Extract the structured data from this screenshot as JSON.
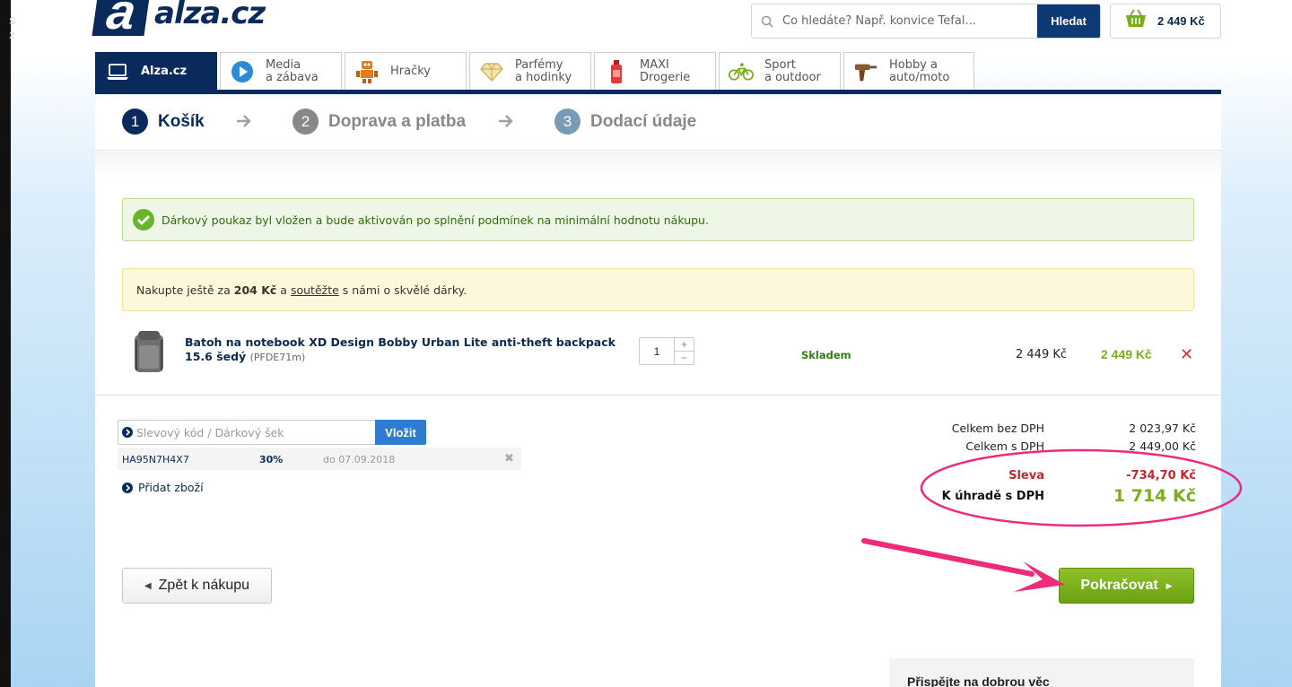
{
  "side_chars": [
    "S",
    "2"
  ],
  "header": {
    "logo_text": "alza.cz",
    "logo_letter": "a",
    "search_placeholder": "Co hledáte? Např. konvice Tefal...",
    "search_button": "Hledat",
    "basket_total": "2 449 Kč"
  },
  "nav": {
    "tabs": [
      {
        "line1": "Alza.cz",
        "line2": "",
        "icon": "laptop-icon"
      },
      {
        "line1": "Media",
        "line2": "a zábava",
        "icon": "play-icon"
      },
      {
        "line1": "Hračky",
        "line2": "",
        "icon": "robot-icon"
      },
      {
        "line1": "Parfémy",
        "line2": "a hodinky",
        "icon": "diamond-icon"
      },
      {
        "line1": "MAXI",
        "line2": "Drogerie",
        "icon": "bottle-icon"
      },
      {
        "line1": "Sport",
        "line2": "a outdoor",
        "icon": "bicycle-icon"
      },
      {
        "line1": "Hobby a",
        "line2": "auto/moto",
        "icon": "drill-icon"
      }
    ]
  },
  "steps": [
    {
      "num": "1",
      "label": "Košík"
    },
    {
      "num": "2",
      "label": "Doprava a platba"
    },
    {
      "num": "3",
      "label": "Dodací údaje"
    }
  ],
  "alerts": {
    "success": "Dárkový poukaz byl vložen a bude aktivován po splnění podmínek na minimální hodnotu nákupu.",
    "info_prefix": "Nakupte ještě za",
    "info_amount": "204 Kč",
    "info_mid": "a",
    "info_link": "soutěžte",
    "info_suffix": "s námi o skvělé dárky."
  },
  "cart_item": {
    "name": "Batoh na notebook XD Design Bobby Urban Lite anti-theft backpack 15.6 šedý",
    "code": "(PFDE71m)",
    "quantity": "1",
    "stock": "Skladem",
    "unit_price": "2 449 Kč",
    "total_price": "2 449 Kč"
  },
  "voucher": {
    "placeholder": "Slevový kód / Dárkový šek",
    "button": "Vložit",
    "applied_code": "HA95N7H4X7",
    "applied_percent": "30%",
    "applied_valid": "do 07.09.2018",
    "add_item": "Přidat zboží"
  },
  "summary": {
    "without_vat_label": "Celkem bez DPH",
    "without_vat_value": "2 023,97 Kč",
    "with_vat_label": "Celkem s DPH",
    "with_vat_value": "2 449,00 Kč",
    "discount_label": "Sleva",
    "discount_value": "-734,70 Kč",
    "to_pay_label": "K úhradě s DPH",
    "to_pay_value": "1 714 Kč"
  },
  "buttons": {
    "back": "Zpět k nákupu",
    "continue": "Pokračovat"
  },
  "charity": "Přispějte na dobrou věc",
  "colors": {
    "brand_navy": "#0a2a5c",
    "price_green": "#7bae1c",
    "discount_red": "#c8262d",
    "annotation_pink": "#ee2a7b"
  }
}
